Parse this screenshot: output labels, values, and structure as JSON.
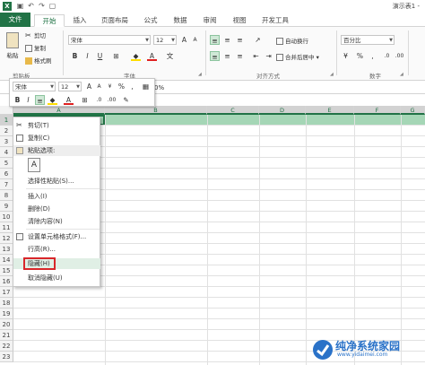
{
  "window": {
    "title": "演示表1 -"
  },
  "tabs": [
    {
      "label": "文件"
    },
    {
      "label": "开始"
    },
    {
      "label": "插入"
    },
    {
      "label": "页面布局"
    },
    {
      "label": "公式"
    },
    {
      "label": "数据"
    },
    {
      "label": "审阅"
    },
    {
      "label": "视图"
    },
    {
      "label": "开发工具"
    }
  ],
  "ribbon": {
    "paste_label": "粘贴",
    "cut_label": "剪切",
    "copy_label": "复制",
    "format_painter_label": "格式刷",
    "clipboard_group": "剪贴板",
    "font_name": "宋体",
    "font_size": "12",
    "font_group": "字体",
    "wrap_text_label": "自动换行",
    "merge_label": "合并后居中",
    "align_group": "对齐方式",
    "number_format": "百分比",
    "number_group": "数字"
  },
  "formula_bar": {
    "text": "0%"
  },
  "mini_toolbar": {
    "font_name": "宋体",
    "font_size": "12"
  },
  "columns": [
    "A",
    "B",
    "C",
    "D",
    "E",
    "F",
    "G"
  ],
  "rows": [
    "1",
    "2",
    "3",
    "4",
    "5",
    "6",
    "7",
    "8",
    "9",
    "10",
    "11",
    "12",
    "13",
    "14",
    "15",
    "16",
    "17",
    "18",
    "19",
    "20",
    "21",
    "22",
    "23"
  ],
  "context_menu": {
    "cut": "剪切(T)",
    "copy": "复制(C)",
    "paste_options": "粘贴选项:",
    "paste_special": "选择性粘贴(S)...",
    "insert": "插入(I)",
    "delete": "删除(D)",
    "clear_contents": "清除内容(N)",
    "format_cells": "设置单元格格式(F)...",
    "row_height": "行高(R)...",
    "hide": "隐藏(H)",
    "unhide": "取消隐藏(U)"
  },
  "watermark": {
    "title": "纯净系统家园",
    "url": "www.yidaimei.com"
  },
  "colors": {
    "accent": "#217346",
    "selection": "#7fc497",
    "highlight_box": "#d8262a"
  }
}
